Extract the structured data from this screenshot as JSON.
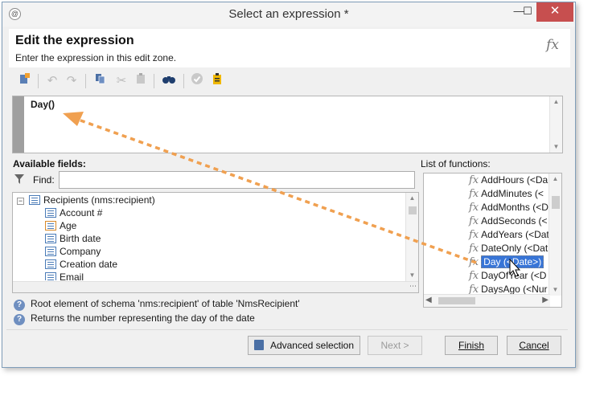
{
  "window": {
    "title": "Select an expression *",
    "minimize_glyph": "—",
    "maximize_glyph": "☐",
    "close_glyph": "✕"
  },
  "header": {
    "title": "Edit the expression",
    "subtitle": "Enter the expression in this edit zone.",
    "logo": "fx"
  },
  "toolbar": {
    "icons": [
      "new-expression-icon",
      "undo-icon",
      "redo-icon",
      "copy-icon",
      "cut-icon",
      "paste-icon",
      "find-icon",
      "validate-icon",
      "clipboard-icon"
    ]
  },
  "editor": {
    "expression": "Day()"
  },
  "available_fields": {
    "label": "Available fields:",
    "find_label": "Find:",
    "find_value": "",
    "root": "Recipients (nms:recipient)",
    "items": [
      "Account #",
      "Age",
      "Birth date",
      "Company",
      "Creation date",
      "Email"
    ]
  },
  "functions": {
    "label": "List of functions:",
    "items": [
      "AddHours (<Da",
      "AddMinutes (<",
      "AddMonths (<D",
      "AddSeconds (<",
      "AddYears (<Dat",
      "DateOnly (<Dat",
      "Day (<Date>)",
      "DayOfYear (<D",
      "DaysAgo (<Nur"
    ],
    "selected_index": 6
  },
  "info": {
    "line1": "Root element of schema 'nms:recipient' of table 'NmsRecipient'",
    "line2": "Returns the number representing the day of the date"
  },
  "buttons": {
    "advanced": "Advanced selection",
    "next": "Next >",
    "finish": "Finish",
    "cancel": "Cancel"
  },
  "colors": {
    "accent": "#3875d7",
    "drag_arrow": "#f0a050",
    "close_button": "#c74f4f"
  }
}
